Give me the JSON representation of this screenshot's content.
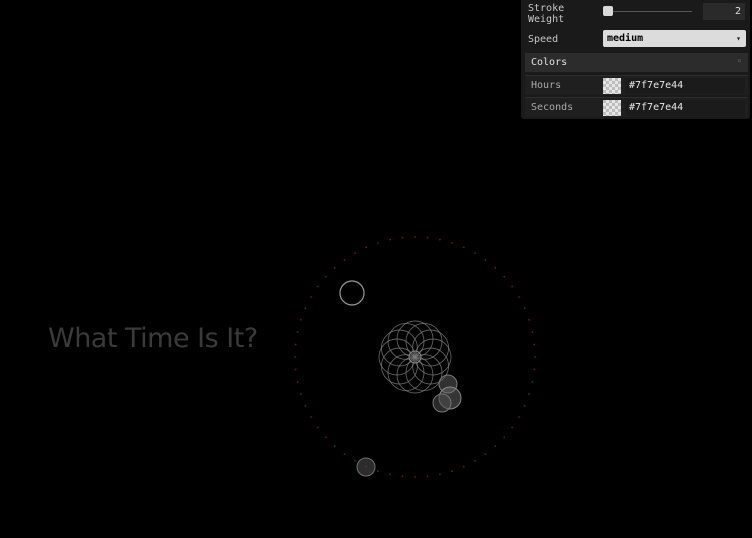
{
  "page": {
    "title": "What Time Is It?"
  },
  "controls": {
    "stroke_weight": {
      "label_line1": "Stroke",
      "label_line2": "Weight",
      "value": "2",
      "level": 0.02
    },
    "speed": {
      "label": "Speed",
      "selected": "medium",
      "arrow": "▾"
    },
    "colors_folder": {
      "label": "Colors",
      "icon": "collapse-icon"
    },
    "hours": {
      "label": "Hours",
      "value": "#7f7e7e44"
    },
    "seconds": {
      "label": "Seconds",
      "value": "#7f7e7e44"
    }
  },
  "theme": {
    "background": "#000000",
    "title_color": "#3a3a3a",
    "tick_color": "#6b1a22",
    "flower_color": "#7f7e7e",
    "ball_color": "#8a8a8a"
  }
}
